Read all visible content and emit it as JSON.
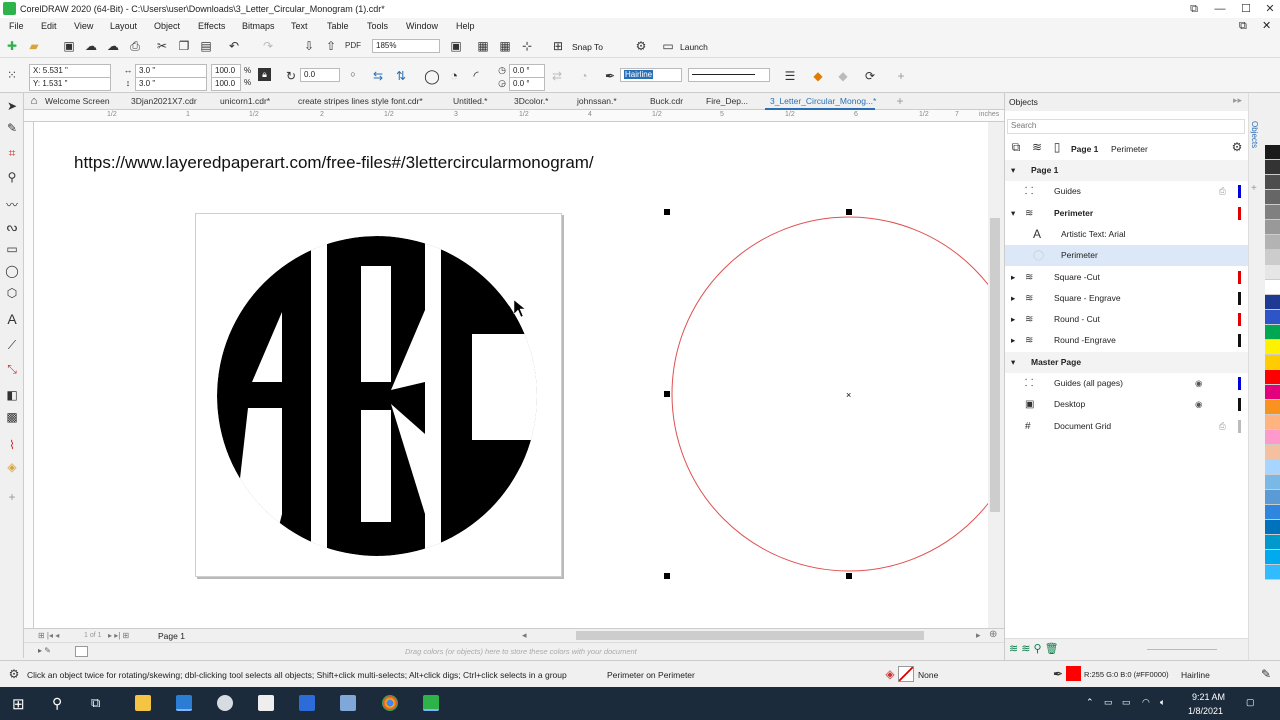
{
  "window": {
    "title": "CorelDRAW 2020 (64-Bit) - C:\\Users\\user\\Downloads\\3_Letter_Circular_Monogram (1).cdr*",
    "minimize": "—",
    "maximize": "☐",
    "close": "✕"
  },
  "menu": [
    "File",
    "Edit",
    "View",
    "Layout",
    "Object",
    "Effects",
    "Bitmaps",
    "Text",
    "Table",
    "Tools",
    "Window",
    "Help"
  ],
  "toolbar": {
    "zoom": "185%",
    "snap_to": "Snap To",
    "launch": "Launch"
  },
  "property_bar": {
    "x": "X: 5.531 \"",
    "y": "Y: 1.531 \"",
    "w": "3.0 \"",
    "h": "3.0 \"",
    "scale_w": "100.0",
    "scale_h": "100.0",
    "percent": "%",
    "angle": "0.0",
    "start_angle": "0.0 °",
    "end_angle": "0.0 °",
    "outline": "Hairline"
  },
  "tabs": [
    "Welcome Screen",
    "3Djan2021X7.cdr",
    "unicorn1.cdr*",
    "create stripes lines style font.cdr*",
    "Untitled.*",
    "3Dcolor.*",
    "johnssan.*",
    "Buck.cdr",
    "Fire_Dep...",
    "3_Letter_Circular_Monog...*"
  ],
  "ruler_labels": [
    "1/2",
    "1",
    "1/2",
    "2",
    "1/2",
    "3",
    "1/2",
    "4",
    "1/2",
    "5",
    "1/2",
    "6",
    "1/2",
    "7",
    "1/2",
    "8",
    "1/2",
    "inches"
  ],
  "canvas": {
    "url": "https://www.layeredpaperart.com/free-files#/3lettercircularmonogram/",
    "monogram": [
      "A",
      "B",
      "C"
    ]
  },
  "page_nav": {
    "label": "Page 1",
    "counter": "1 of 1"
  },
  "palette_hint": "Drag colors (or objects) here to store these colors with your document",
  "objects": {
    "header": "Objects",
    "search_placeholder": "Search",
    "page_label": "Page 1",
    "current": "Perimeter",
    "rows": [
      {
        "label": "Page 1",
        "bold": true,
        "indent": 0,
        "expander": "▾"
      },
      {
        "label": "Guides",
        "indent": 1,
        "color": "#0000dd",
        "icon": "guides-icon"
      },
      {
        "label": "Perimeter",
        "bold": true,
        "indent": 1,
        "expander": "▾",
        "color": "#e00000",
        "icon": "layer-icon"
      },
      {
        "label": "Artistic Text: Arial",
        "indent": 2,
        "icon": "text-icon"
      },
      {
        "label": "Perimeter",
        "indent": 2,
        "selected": true,
        "icon": "ellipse-icon"
      },
      {
        "label": "Square -Cut",
        "indent": 1,
        "expander": "▸",
        "color": "#e00000",
        "icon": "layer-icon"
      },
      {
        "label": "Square - Engrave",
        "indent": 1,
        "expander": "▸",
        "color": "#111111",
        "icon": "layer-icon"
      },
      {
        "label": "Round - Cut",
        "indent": 1,
        "expander": "▸",
        "color": "#e00000",
        "icon": "layer-icon"
      },
      {
        "label": "Round -Engrave",
        "indent": 1,
        "expander": "▸",
        "color": "#111111",
        "icon": "layer-icon"
      },
      {
        "label": "Master Page",
        "bold": true,
        "indent": 0,
        "expander": "▾"
      },
      {
        "label": "Guides (all pages)",
        "indent": 1,
        "color": "#0000dd",
        "icon": "guides-icon"
      },
      {
        "label": "Desktop",
        "indent": 1,
        "color": "#111111",
        "icon": "desktop-icon"
      },
      {
        "label": "Document Grid",
        "indent": 1,
        "color": "#bbbbbb",
        "icon": "grid-icon"
      }
    ]
  },
  "side_tab": "Objects",
  "palette": [
    "#1a1a1a",
    "#333333",
    "#4d4d4d",
    "#666666",
    "#808080",
    "#999999",
    "#b3b3b3",
    "#cccccc",
    "#e6e6e6",
    "#ffffff",
    "#1f3a93",
    "#2e55c8",
    "#00a651",
    "#fff200",
    "#ffcc00",
    "#ff0000",
    "#e4007c",
    "#f7931e",
    "#ffb380",
    "#ff99cc",
    "#f4c0a0",
    "#a8d5ff",
    "#7ab8e6",
    "#5a9bd6",
    "#2e86de",
    "#0072bc",
    "#0099cc",
    "#00aaee",
    "#33bbff"
  ],
  "status": {
    "hint": "Click an object twice for rotating/skewing; dbl-clicking tool selects all objects; Shift+click multi-selects; Alt+click digs; Ctrl+click selects in a group",
    "object": "Perimeter on Perimeter",
    "fill": "None",
    "color": "R:255 G:0 B:0 (#FF0000)",
    "outline": "Hairline",
    "outline_color": "#ff0000"
  },
  "taskbar": {
    "time": "9:21 AM",
    "date": "1/8/2021"
  }
}
